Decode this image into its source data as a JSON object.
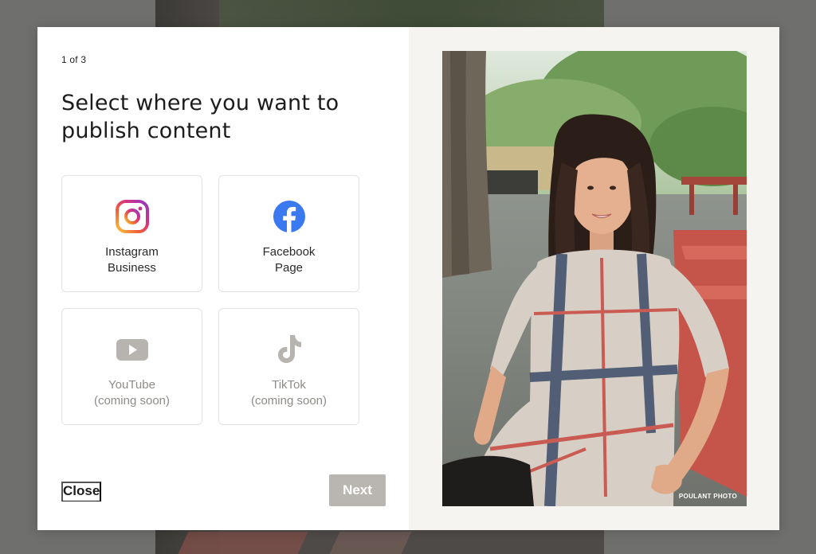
{
  "modal": {
    "step_indicator": "1 of 3",
    "title": "Select where you want to publish content",
    "options": [
      {
        "label": "Instagram\nBusiness",
        "icon": "instagram-icon",
        "enabled": true
      },
      {
        "label": "Facebook\nPage",
        "icon": "facebook-icon",
        "enabled": true
      },
      {
        "label": "YouTube\n(coming soon)",
        "icon": "youtube-icon",
        "enabled": false
      },
      {
        "label": "TikTok\n(coming soon)",
        "icon": "tiktok-icon",
        "enabled": false
      }
    ],
    "close_label": "Close",
    "next_label": "Next"
  },
  "photo": {
    "credit": "POULANT PHOTO"
  },
  "colors": {
    "facebook": "#3b79f0",
    "disabled_icon": "#b7b4af",
    "next_button": "#b9b6b1",
    "right_pane": "#f5f4f1"
  }
}
